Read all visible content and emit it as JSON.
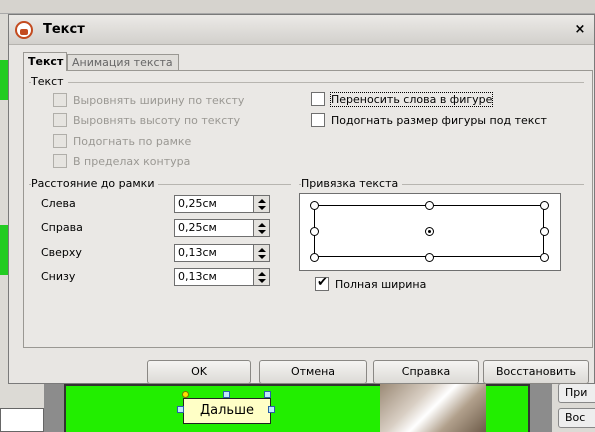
{
  "dialog": {
    "title": "Текст",
    "close_glyph": "×"
  },
  "tabs": [
    {
      "label": "Текст",
      "active": true
    },
    {
      "label": "Анимация текста",
      "active": false
    }
  ],
  "text_group": {
    "title": "Текст",
    "left_options": [
      {
        "label": "Выровнять ширину по тексту",
        "checked": false,
        "enabled": false
      },
      {
        "label": "Выровнять высоту по тексту",
        "checked": false,
        "enabled": false
      },
      {
        "label": "Подогнать по рамке",
        "checked": false,
        "enabled": false
      },
      {
        "label": "В пределах контура",
        "checked": false,
        "enabled": false
      }
    ],
    "right_options": [
      {
        "label": "Переносить слова в фигуре",
        "checked": false,
        "enabled": true
      },
      {
        "label": "Подогнать размер фигуры под текст",
        "checked": false,
        "enabled": true
      }
    ]
  },
  "spacing_group": {
    "title": "Расстояние до рамки",
    "fields": [
      {
        "label": "Слева",
        "value": "0,25см"
      },
      {
        "label": "Справа",
        "value": "0,25см"
      },
      {
        "label": "Сверху",
        "value": "0,13см"
      },
      {
        "label": "Снизу",
        "value": "0,13см"
      }
    ]
  },
  "anchor_group": {
    "title": "Привязка текста",
    "selected": "center",
    "full_width_label": "Полная ширина",
    "full_width_checked": true
  },
  "buttons": {
    "ok": "OK",
    "cancel": "Отмена",
    "help": "Справка",
    "reset": "Восстановить"
  },
  "background": {
    "slide_textbox": "Дальше",
    "right_btn1": "При",
    "right_btn2": "Вос",
    "slide_color": "#22ee00"
  }
}
